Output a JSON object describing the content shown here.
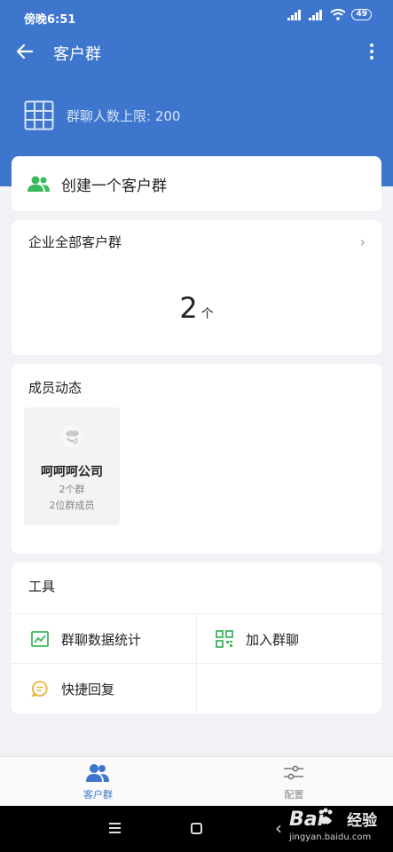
{
  "status": {
    "time": "傍晚6:51",
    "battery": "49"
  },
  "nav": {
    "title": "客户群"
  },
  "limit": {
    "text": "群聊人数上限: 200"
  },
  "create": {
    "label": "创建一个客户群"
  },
  "all_groups": {
    "title": "企业全部客户群",
    "count": "2",
    "unit": "个"
  },
  "members": {
    "title": "成员动态",
    "items": [
      {
        "name": "呵呵呵公司",
        "groups": "2个群",
        "member_count": "2位群成员"
      }
    ]
  },
  "tools": {
    "title": "工具",
    "items": [
      {
        "label": "群聊数据统计",
        "icon": "chart-icon"
      },
      {
        "label": "加入群聊",
        "icon": "qr-code-icon"
      },
      {
        "label": "快捷回复",
        "icon": "quick-reply-icon"
      }
    ]
  },
  "tabs": [
    {
      "label": "客户群",
      "icon": "people-icon",
      "active": true
    },
    {
      "label": "配置",
      "icon": "settings-sliders-icon",
      "active": false
    }
  ],
  "watermark": {
    "brand": "Bai",
    "brand2": "经验",
    "url": "jingyan.baidu.com"
  },
  "colors": {
    "primary": "#3d76cc",
    "green": "#3bb85c",
    "yellow": "#e8b33a"
  }
}
